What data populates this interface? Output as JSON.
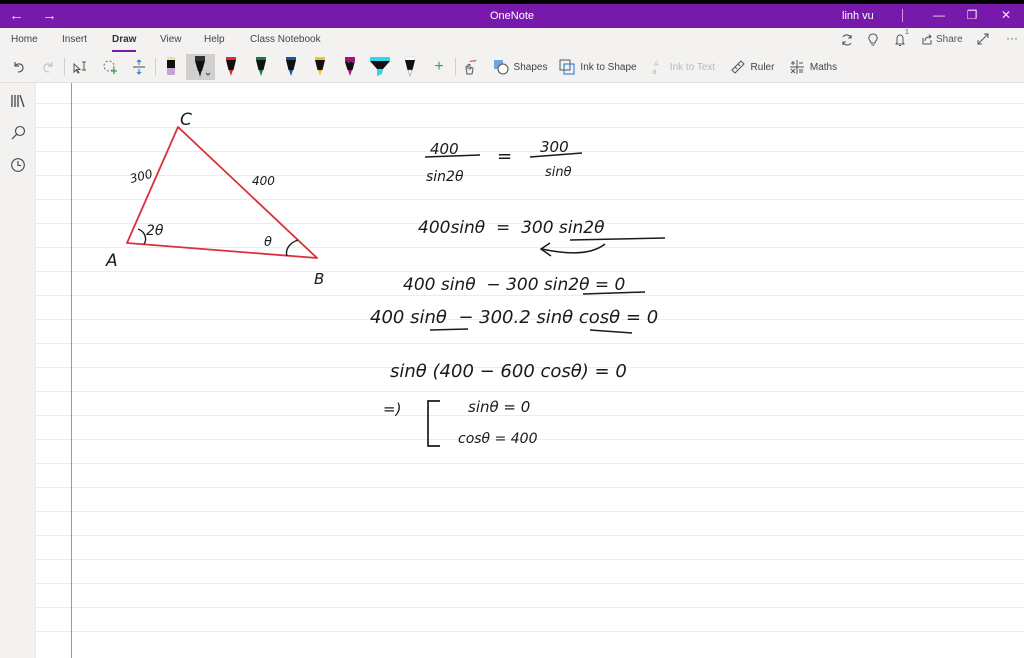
{
  "window": {
    "app_title": "OneNote",
    "user_name": "linh vu",
    "controls": {
      "minimize": "—",
      "restore": "❐",
      "close": "✕"
    },
    "nav": {
      "back": "←",
      "forward": "→"
    }
  },
  "ribbon": {
    "tabs": [
      {
        "label": "Home",
        "active": false
      },
      {
        "label": "Insert",
        "active": false
      },
      {
        "label": "Draw",
        "active": true
      },
      {
        "label": "View",
        "active": false
      },
      {
        "label": "Help",
        "active": false
      },
      {
        "label": "Class Notebook",
        "active": false
      }
    ],
    "right_actions": {
      "sync": "sync-icon",
      "tell_me": "lightbulb-icon",
      "notifications": "bell-icon",
      "notification_count": "1",
      "share_label": "Share",
      "fullscreen": "expand-icon",
      "more": "···"
    },
    "tools": {
      "undo": "undo-icon",
      "redo": "redo-icon",
      "type_select": "lasso-type-icon",
      "lasso": "lasso-select-icon",
      "add_space": "insert-space-icon",
      "pens": [
        {
          "name": "eraser",
          "color": "#c9a0d8"
        },
        {
          "name": "black-pen",
          "color": "#222222",
          "selected": true
        },
        {
          "name": "red-pen",
          "color": "#e3262f"
        },
        {
          "name": "green-pen",
          "color": "#107c41"
        },
        {
          "name": "blue-pen",
          "color": "#0f5aa8"
        },
        {
          "name": "yellow-pen",
          "color": "#f2c02b"
        },
        {
          "name": "purple-pen",
          "color": "#a4127f"
        },
        {
          "name": "cyan-highlighter",
          "color": "#2fd8e6"
        },
        {
          "name": "white-pen",
          "color": "#ffffff"
        }
      ],
      "add_pen": "+",
      "touch_draw": "touch-draw-icon",
      "shapes_label": "Shapes",
      "ink_to_shape_label": "Ink to Shape",
      "ink_to_text_label": "Ink to Text",
      "ruler_label": "Ruler",
      "maths_label": "Maths"
    }
  },
  "sidebar": {
    "items": [
      "notebooks-icon",
      "search-icon",
      "recent-icon"
    ]
  },
  "page": {
    "ink_color": "#1a1a1a",
    "triangle": {
      "stroke_color": "#d9303c",
      "vertex_labels": {
        "A": "A",
        "B": "B",
        "C": "C"
      },
      "side_AC": "300",
      "side_BC": "400",
      "angle_A": "2θ",
      "angle_B": "θ"
    },
    "equations": {
      "eq1_num_left": "400",
      "eq1_den_left": "sin2θ",
      "eq1_eq": "=",
      "eq1_num_right": "300",
      "eq1_den_right": "sinθ",
      "eq2": "400sinθ  =  300 sin2θ",
      "eq3": "400 sinθ  − 300 sin2θ = 0",
      "eq4": "400 sinθ  − 300.2 sinθ cosθ = 0",
      "eq5": "sinθ (400 − 600 cosθ) = 0",
      "implies": "=)",
      "case1": "sinθ = 0",
      "case2": "cosθ = 400"
    }
  }
}
